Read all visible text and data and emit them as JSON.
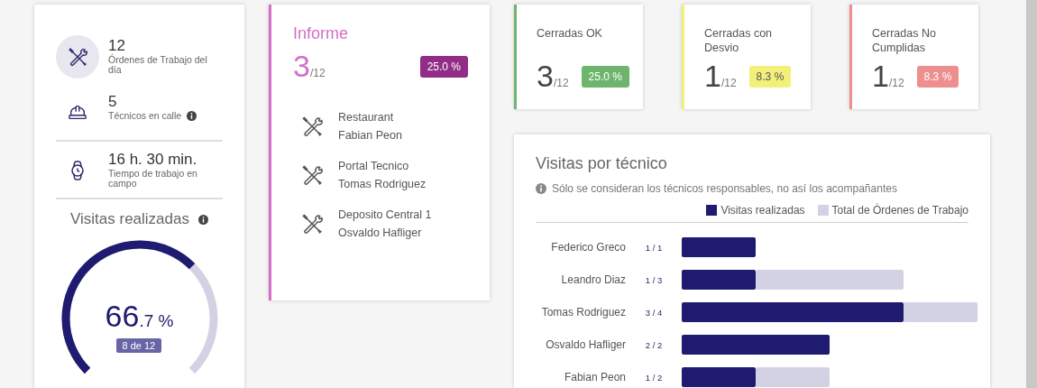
{
  "summary": {
    "stats": [
      {
        "kind": "orders",
        "value": "12",
        "label": "Órdenes de Trabajo del día",
        "info": false
      },
      {
        "kind": "technicians",
        "value": "5",
        "label": "Técnicos en calle",
        "info": true
      },
      {
        "kind": "time",
        "value": "16 h. 30 min.",
        "label": "Tiempo de trabajo en campo",
        "info": false
      }
    ],
    "gauge": {
      "title": "Visitas realizadas",
      "percent_whole": "66",
      "percent_rest": ".7 %",
      "count": "8 de 12"
    }
  },
  "report": {
    "title": "Informe",
    "value": "3",
    "total": "/12",
    "badge": "25.0 %",
    "color": "#d36fc6",
    "items": [
      {
        "place": "Restaurant",
        "technician": "Fabian Peon"
      },
      {
        "place": "Portal Tecnico",
        "technician": "Tomas Rodriguez"
      },
      {
        "place": "Deposito Central 1",
        "technician": "Osvaldo Hafliger"
      }
    ]
  },
  "status_cards": [
    {
      "title": "Cerradas OK",
      "value": "3",
      "total": "/12",
      "badge": "25.0 %",
      "color": "#6db56d"
    },
    {
      "title": "Cerradas con Desvio",
      "value": "1",
      "total": "/12",
      "badge": "8.3 %",
      "color": "#f3f07a"
    },
    {
      "title": "Cerradas No Cumplidas",
      "value": "1",
      "total": "/12",
      "badge": "8.3 %",
      "color": "#ee8f8f"
    }
  ],
  "visits": {
    "title": "Visitas por técnico",
    "note": "Sólo se consideran los técnicos responsables, no así los acompañantes",
    "legend": [
      {
        "label": "Visitas realizadas",
        "color": "#1e1b70"
      },
      {
        "label": "Total de Órdenes de Trabajo",
        "color": "#d3d2e5"
      }
    ],
    "rows": [
      {
        "name": "Federico Greco",
        "ratio": "1 / 1"
      },
      {
        "name": "Leandro Diaz",
        "ratio": "1 / 3"
      },
      {
        "name": "Tomas Rodriguez",
        "ratio": "3 / 4"
      },
      {
        "name": "Osvaldo Hafliger",
        "ratio": "2 / 2"
      },
      {
        "name": "Fabian Peon",
        "ratio": "1 / 2"
      }
    ]
  }
}
